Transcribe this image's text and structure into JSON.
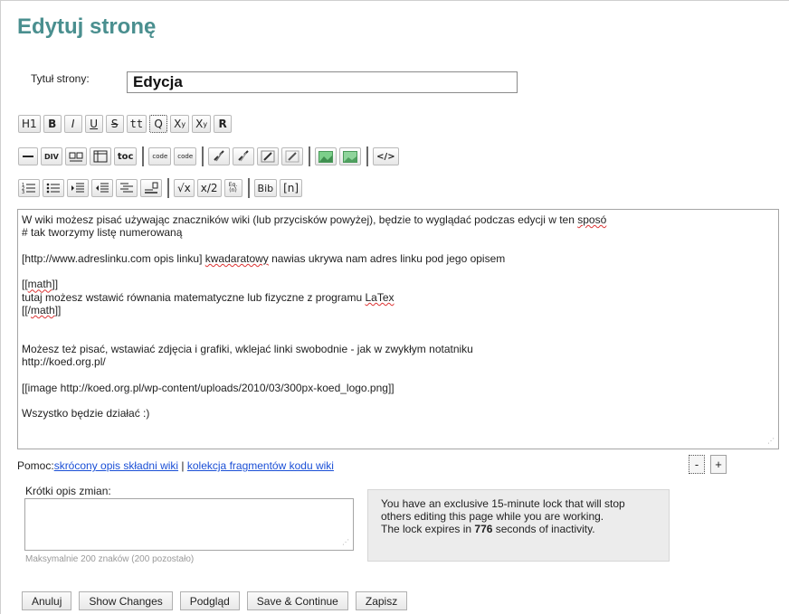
{
  "page": {
    "title": "Edytuj stronę"
  },
  "title_field": {
    "label": "Tytuł strony:",
    "value": "Edycja"
  },
  "toolbar": {
    "row1": [
      "H1",
      "B",
      "I",
      "U",
      "S",
      "tt",
      "Q",
      "X",
      "X",
      "R"
    ],
    "row1_sup": "y",
    "row2_div": "DIV",
    "row2_toc": "toc",
    "row2_code1": "code",
    "row2_code2": "code",
    "row2_source": "</>",
    "row3_sqrt": "√x",
    "row3_frac": "x/2",
    "row3_eq": "Eq.",
    "row3_eq_n": "(n)",
    "row3_bib": "Bib",
    "row3_ref": "[n]"
  },
  "editor": {
    "line1a": "W wiki możesz pisać używając znaczników wiki (lub przycisków powyżej), będzie to wyglądać podczas edycji w ten ",
    "line1b": "sposó",
    "line2": "# tak tworzymy listę numerowaną",
    "line4a": "[http://www.adreslinku.com opis linku] ",
    "line4b": "kwadaratowy",
    "line4c": " nawias ukrywa nam adres linku pod jego opisem",
    "line6a": "[[",
    "line6b": "math",
    "line6c": "]]",
    "line7a": "tutaj możesz wstawić równania matematyczne lub fizyczne z programu ",
    "line7b": "LaTex",
    "line8a": "[[/",
    "line8b": "math",
    "line8c": "]]",
    "line11": "Możesz też pisać, wstawiać zdjęcia i grafiki, wklejać linki swobodnie - jak w zwykłym notatniku",
    "line12": "http://koed.org.pl/",
    "line14": "[[image http://koed.org.pl/wp-content/uploads/2010/03/300px-koed_logo.png]]",
    "line16": "Wszystko będzie działać :)"
  },
  "help": {
    "prefix": "Pomoc:",
    "link1": "skrócony opis składni wiki",
    "separator": " | ",
    "link2": "kolekcja fragmentów kodu wiki"
  },
  "resize": {
    "minus": "-",
    "plus": "+"
  },
  "summary": {
    "label": "Krótki opis zmian:",
    "value": "",
    "hint": "Maksymalnie 200 znaków (200 pozostało)"
  },
  "lock": {
    "line1": "You have an exclusive 15-minute lock that will stop others editing this page while you are working.",
    "line2a": "The lock expires in ",
    "seconds": "776",
    "line2b": " seconds of inactivity."
  },
  "buttons": {
    "cancel": "Anuluj",
    "show_changes": "Show Changes",
    "preview": "Podgląd",
    "save_continue": "Save & Continue",
    "save": "Zapisz"
  },
  "colors": {
    "title": "#4a8f8f",
    "link": "#1a4fd6",
    "lock_bg": "#ececec"
  }
}
